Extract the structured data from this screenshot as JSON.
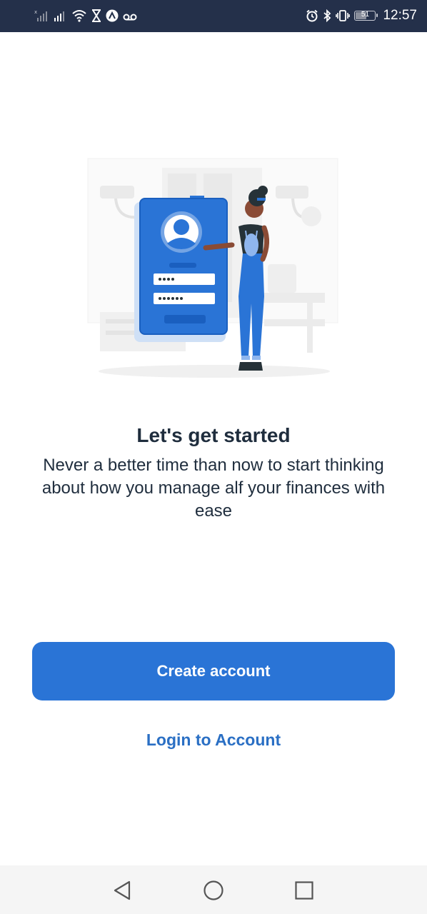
{
  "status_bar": {
    "time": "12:57",
    "battery_level": "51",
    "battery_fraction": 0.51,
    "left_icons": [
      "signal-no-sim-icon",
      "signal-icon",
      "wifi-icon",
      "hourglass-icon",
      "app-notification-icon",
      "voicemail-icon"
    ],
    "right_icons": [
      "alarm-icon",
      "bluetooth-icon",
      "vibrate-icon",
      "battery-icon"
    ]
  },
  "illustration": {
    "icon": "login-illustration",
    "accent_color": "#2a74d6"
  },
  "onboarding": {
    "title": "Let's get started",
    "subtitle": "Never a better time than now to start thinking about how you manage alf your finances with ease"
  },
  "actions": {
    "create_account_label": "Create account",
    "login_label": "Login to Account"
  },
  "nav_bar": {
    "icons": [
      "back-icon",
      "home-icon",
      "recents-icon"
    ]
  },
  "colors": {
    "status_bar_bg": "#24304a",
    "primary": "#2a74d6",
    "link": "#2a6fc4",
    "text": "#1f2d3d",
    "nav_bg": "#f5f5f5"
  }
}
